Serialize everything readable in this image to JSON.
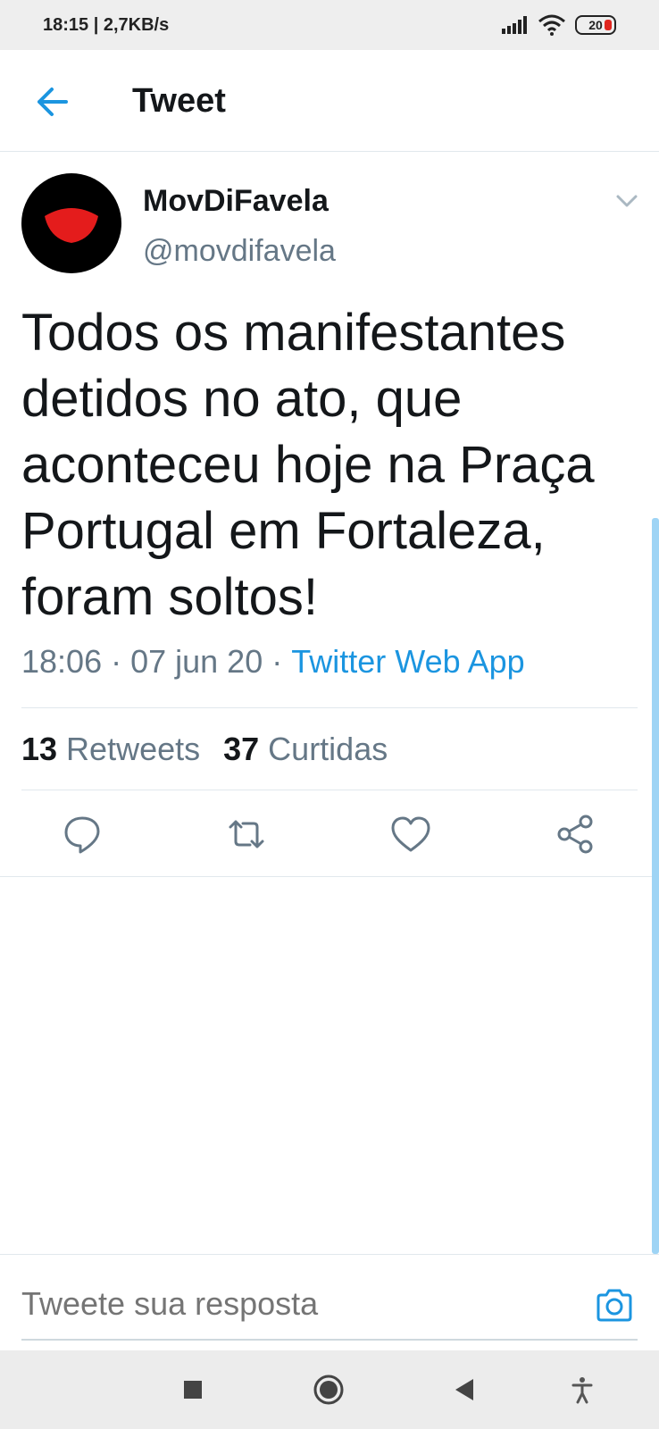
{
  "status_bar": {
    "time_speed": "18:15 | 2,7KB/s",
    "battery": "20"
  },
  "header": {
    "title": "Tweet"
  },
  "tweet": {
    "author_name": "MovDiFavela",
    "author_handle": "@movdifavela",
    "text": "Todos os manifestantes detidos no ato, que aconteceu hoje na Praça Portugal em Fortaleza, foram soltos!",
    "time": "18:06",
    "date": "07 jun 20",
    "source": "Twitter Web App",
    "separator": "·",
    "retweets_count": "13",
    "retweets_label": "Retweets",
    "likes_count": "37",
    "likes_label": "Curtidas"
  },
  "reply": {
    "placeholder": "Tweete sua resposta"
  },
  "colors": {
    "accent": "#1b95e0",
    "secondary_text": "#657786",
    "primary_text": "#14171a",
    "avatar_mark": "#e41c1c"
  },
  "icons": [
    "back-arrow-icon",
    "chevron-down-icon",
    "reply-icon",
    "retweet-icon",
    "like-icon",
    "share-icon",
    "camera-icon",
    "stop-square-icon",
    "home-circle-icon",
    "back-triangle-icon",
    "accessibility-icon"
  ]
}
